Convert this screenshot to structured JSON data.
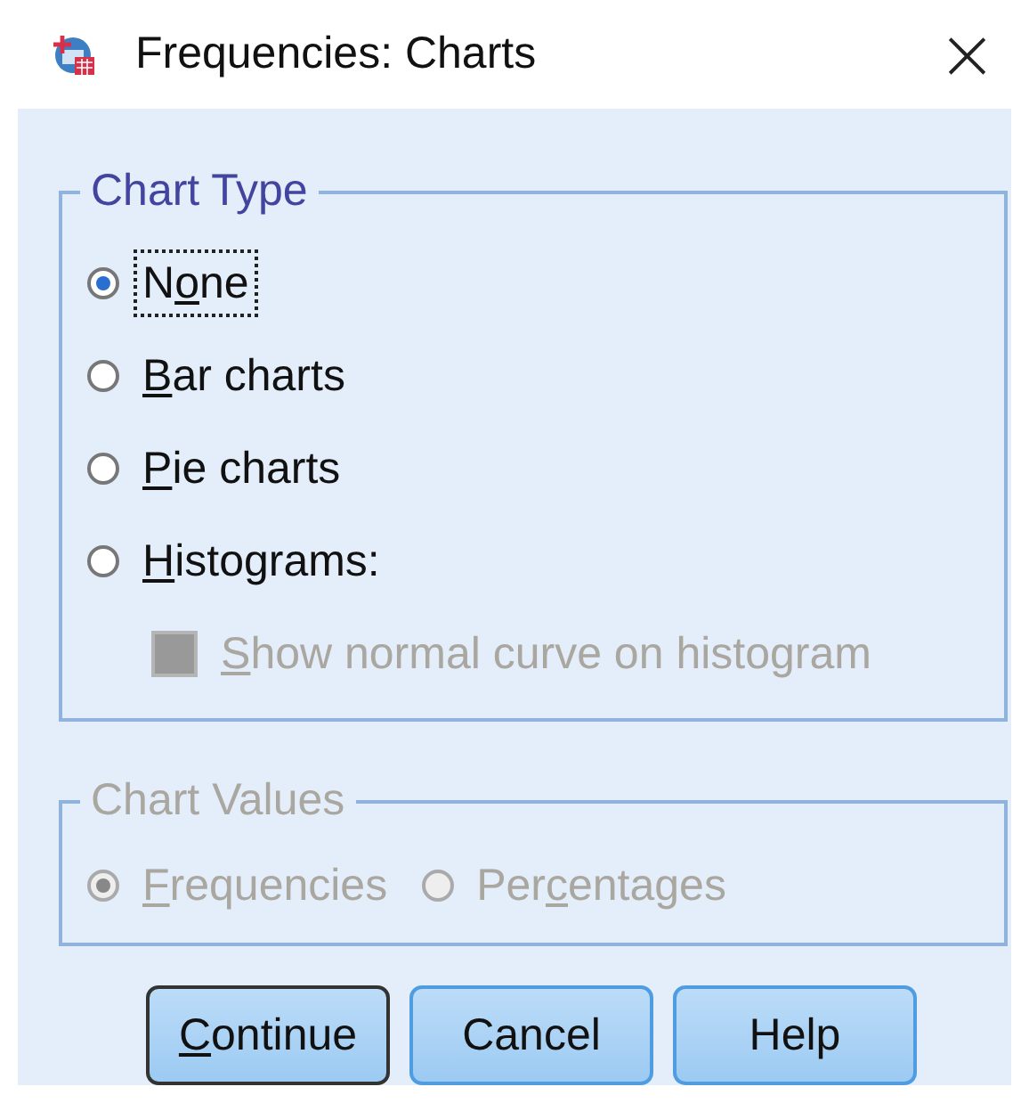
{
  "window": {
    "title": "Frequencies: Charts",
    "close": "×"
  },
  "chart_type": {
    "title": "Chart Type",
    "options": [
      {
        "kind": "radio",
        "before": "N",
        "key": "o",
        "after": "ne",
        "selected": true,
        "focused": true,
        "disabled": false
      },
      {
        "kind": "radio",
        "key": "B",
        "after": "ar charts",
        "selected": false,
        "focused": false,
        "disabled": false
      },
      {
        "kind": "radio",
        "key": "P",
        "after": "ie charts",
        "selected": false,
        "focused": false,
        "disabled": false
      },
      {
        "kind": "radio",
        "key": "H",
        "after": "istograms:",
        "selected": false,
        "focused": false,
        "disabled": false
      },
      {
        "kind": "checkbox",
        "key": "S",
        "after": "how normal curve on histogram",
        "checked": false,
        "focused": false,
        "disabled": true
      }
    ]
  },
  "chart_values": {
    "title": "Chart Values",
    "disabled": true,
    "options": [
      {
        "kind": "radio",
        "key": "F",
        "after": "requencies",
        "selected": true,
        "focused": false,
        "disabled": true
      },
      {
        "kind": "radio",
        "before": "Per",
        "key": "c",
        "after": "entages",
        "selected": false,
        "focused": false,
        "disabled": true
      }
    ]
  },
  "buttons": [
    {
      "key": "C",
      "after": "ontinue",
      "default": true
    },
    {
      "before": "Cancel",
      "default": false
    },
    {
      "before": "Help",
      "default": false
    }
  ]
}
